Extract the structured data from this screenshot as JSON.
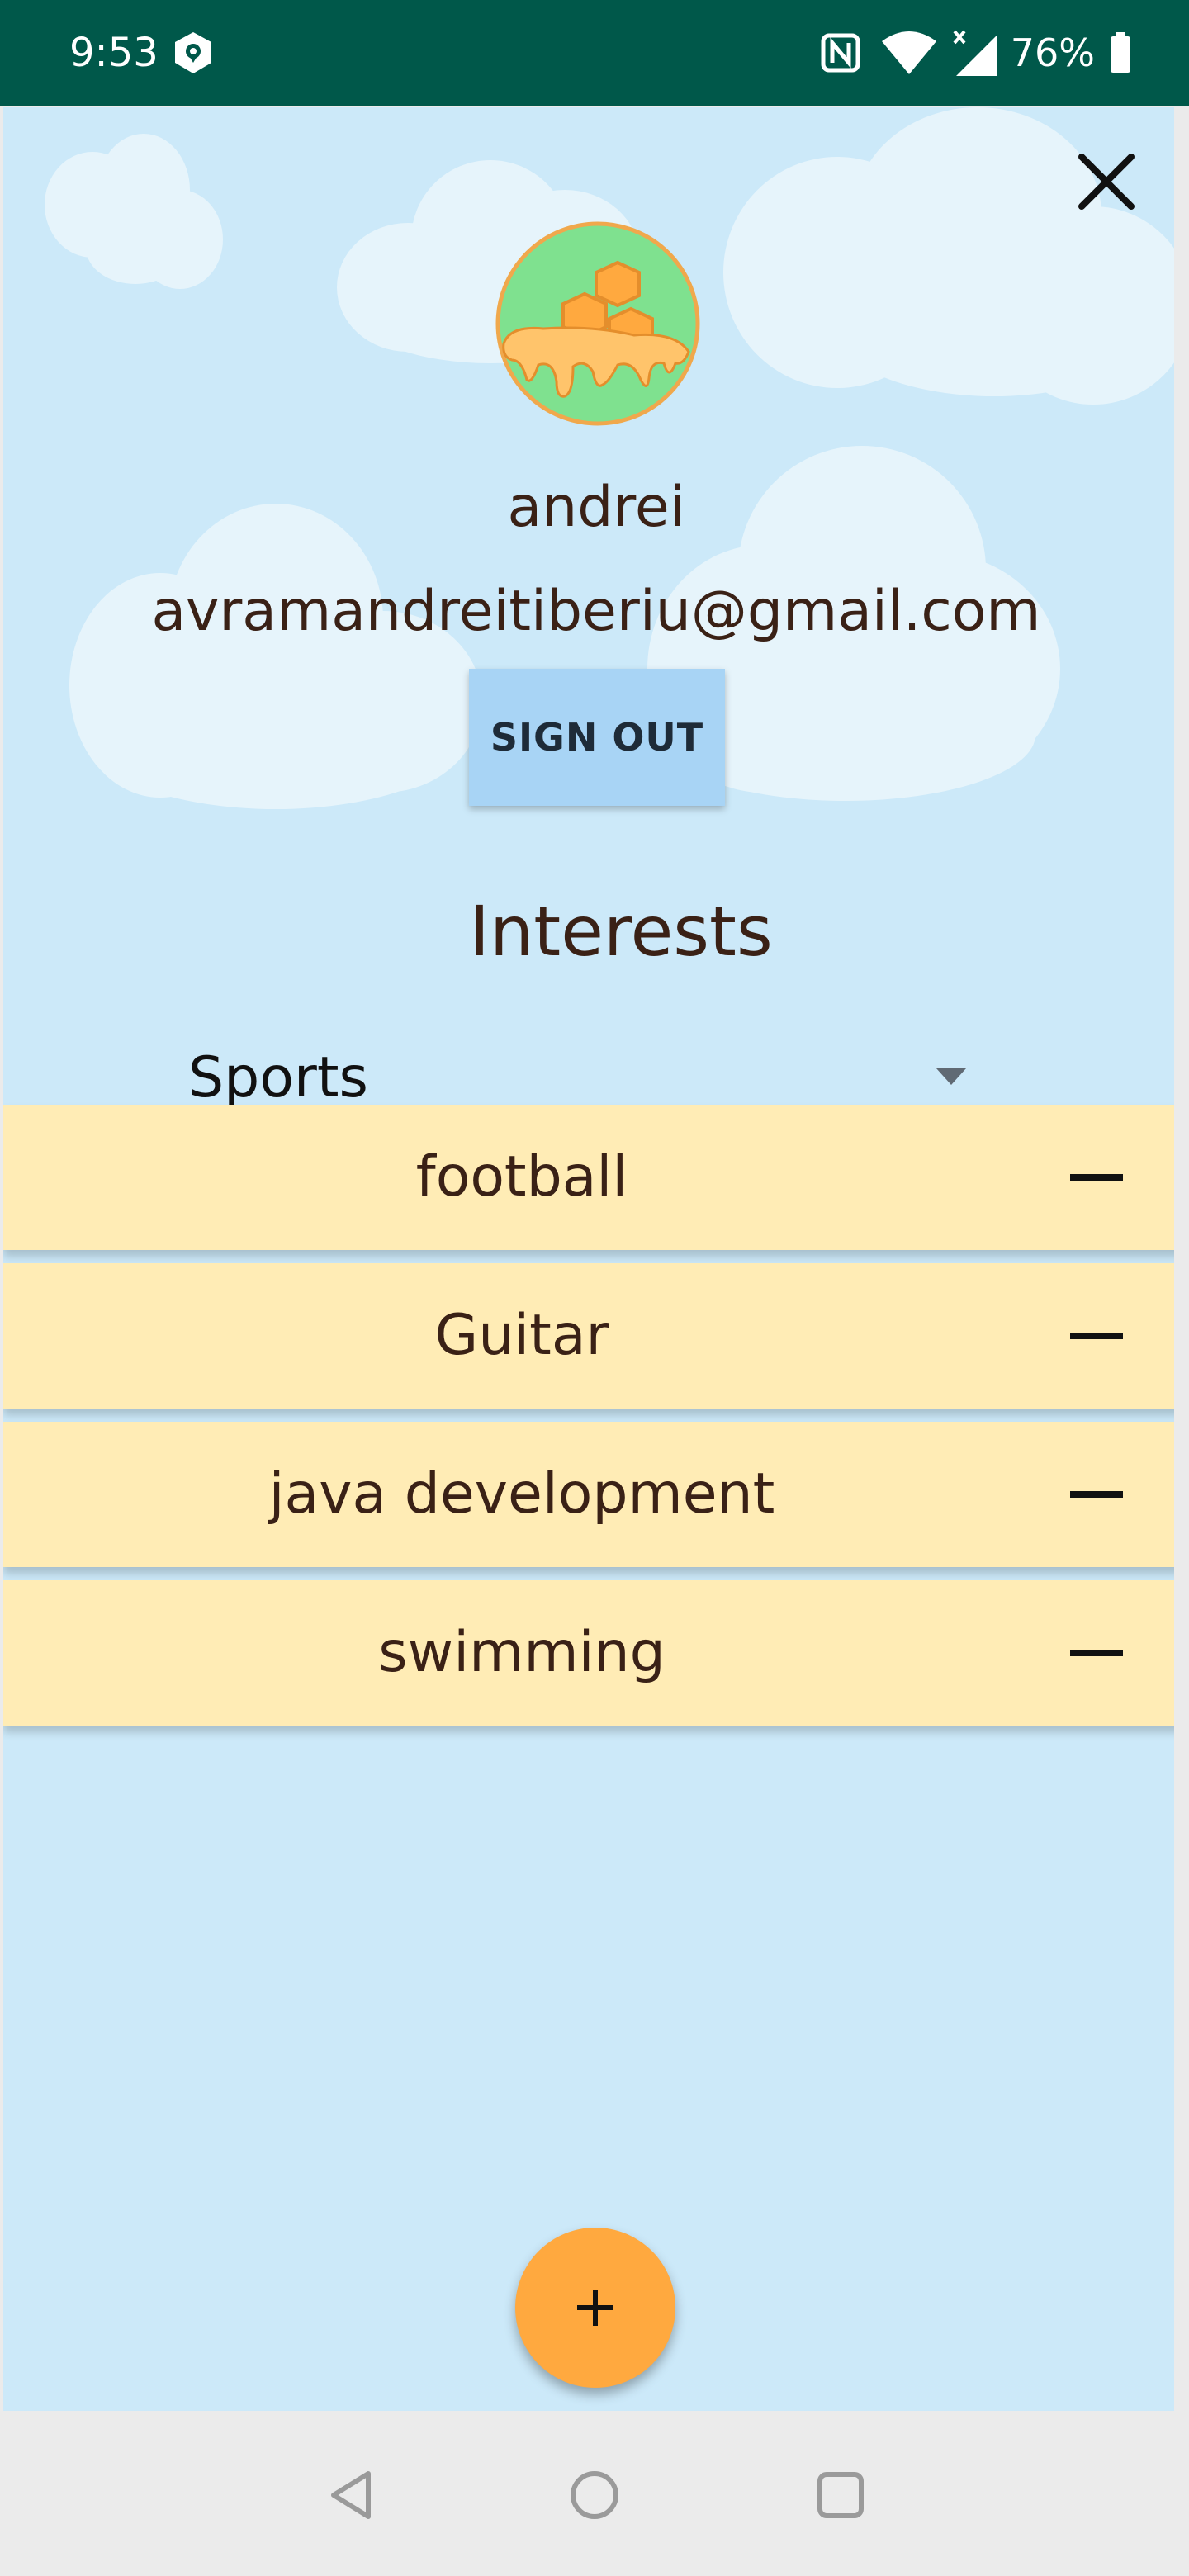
{
  "status_bar": {
    "time": "9:53",
    "battery": "76%",
    "icons": [
      "shield-notification-icon",
      "nfc-icon",
      "wifi-icon",
      "signal-icon",
      "battery-icon"
    ]
  },
  "profile": {
    "name": "andrei",
    "email": "avramandreitiberiu@gmail.com",
    "avatar_icon": "honeycomb-icon",
    "sign_out_label": "SIGN OUT"
  },
  "interests": {
    "title": "Interests",
    "category_selected": "Sports",
    "items": [
      {
        "label": "football"
      },
      {
        "label": "Guitar"
      },
      {
        "label": "java development"
      },
      {
        "label": "swimming"
      }
    ],
    "remove_icon": "minus-icon",
    "add_icon": "plus-icon"
  },
  "colors": {
    "status_bar": "#00584a",
    "background": "#cce9f9",
    "sign_out_button": "#a8d4f5",
    "interest_row": "#ffecb5",
    "fab": "#ffa93f",
    "text": "#3a2116"
  },
  "navigation": {
    "icons": [
      "back-icon",
      "home-icon",
      "recents-icon"
    ]
  }
}
